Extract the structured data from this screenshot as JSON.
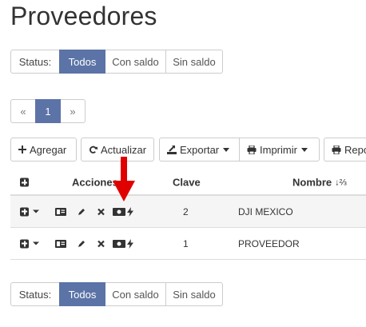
{
  "page": {
    "title": "Proveedores"
  },
  "status_filter": {
    "label": "Status:",
    "options": [
      "Todos",
      "Con saldo",
      "Sin saldo"
    ],
    "selected": "Todos"
  },
  "pagination": {
    "prev": "«",
    "current": "1",
    "next": "»"
  },
  "toolbar": {
    "agregar": "Agregar",
    "actualizar": "Actualizar",
    "exportar": "Exportar",
    "imprimir": "Imprimir",
    "reportes": "Repo"
  },
  "table": {
    "headers": {
      "acciones": "Acciones",
      "clave": "Clave",
      "nombre": "Nombre"
    },
    "sort_indicator": "↓⅔",
    "rows": [
      {
        "clave": "2",
        "nombre": "DJI MEXICO"
      },
      {
        "clave": "1",
        "nombre": "PROVEEDOR"
      }
    ]
  },
  "colors": {
    "accent": "#5b73a6",
    "annotation_arrow": "#e00000",
    "border": "#cccccc",
    "row_shade": "#f5f5f5"
  },
  "icons": [
    "plus-square-icon",
    "caret-down-icon",
    "id-card-icon",
    "pencil-icon",
    "close-icon",
    "money-icon",
    "bolt-icon",
    "refresh-icon",
    "export-icon",
    "print-icon",
    "sort-alpha-icon"
  ]
}
